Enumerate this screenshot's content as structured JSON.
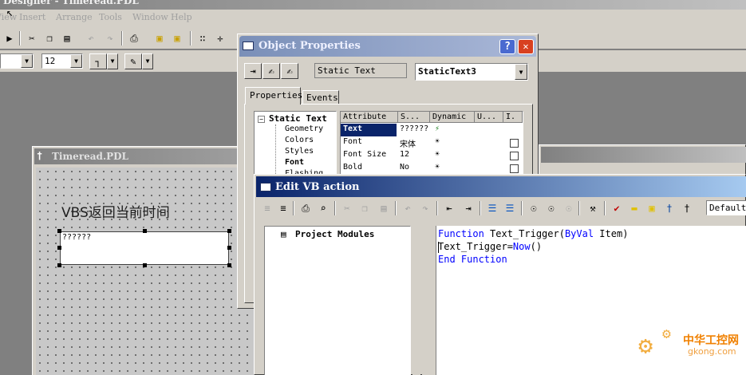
{
  "app": {
    "title": "Designer - Timeread.PDL",
    "menu": [
      "View",
      "Insert",
      "Arrange",
      "Tools",
      "Window",
      "Help"
    ],
    "font_size_value": "12"
  },
  "object_properties": {
    "title": "Object Properties",
    "help_label": "?",
    "close_label": "✕",
    "object_type": "Static Text",
    "object_name": "StaticText3",
    "tabs": [
      "Properties",
      "Events"
    ],
    "tree": {
      "root": "Static Text",
      "children": [
        "Geometry",
        "Colors",
        "Styles",
        "Font",
        "Flashing"
      ]
    },
    "columns": [
      "Attribute",
      "S...",
      "Dynamic",
      "U...",
      "I."
    ],
    "rows": [
      {
        "attribute": "Text",
        "static": "??????",
        "dynamic": "lightning",
        "selected": true
      },
      {
        "attribute": "Font",
        "static": "宋体",
        "dynamic": "bulb",
        "selected": false
      },
      {
        "attribute": "Font Size",
        "static": "12",
        "dynamic": "bulb",
        "selected": false
      },
      {
        "attribute": "Bold",
        "static": "No",
        "dynamic": "bulb",
        "selected": false
      }
    ]
  },
  "timeread_window": {
    "title": "Timeread.PDL",
    "label_text": "VBS返回当前时间",
    "static_text_value": "??????"
  },
  "vb_editor": {
    "title": "Edit VB action",
    "tree_root": "Project Modules",
    "font_combo": "Default",
    "code_lines": [
      [
        {
          "t": "Function",
          "kw": true
        },
        {
          "t": " Text_Trigger(",
          "kw": false
        },
        {
          "t": "ByVal",
          "kw": true
        },
        {
          "t": " Item)",
          "kw": false
        }
      ],
      [
        {
          "t": "Text_Trigger=",
          "kw": false
        },
        {
          "t": "Now",
          "kw": true
        },
        {
          "t": "()",
          "kw": false
        }
      ],
      [
        {
          "t": "End Function",
          "kw": true
        }
      ]
    ]
  },
  "watermark": {
    "cn": "中华工控网",
    "url": "gkong.com"
  }
}
